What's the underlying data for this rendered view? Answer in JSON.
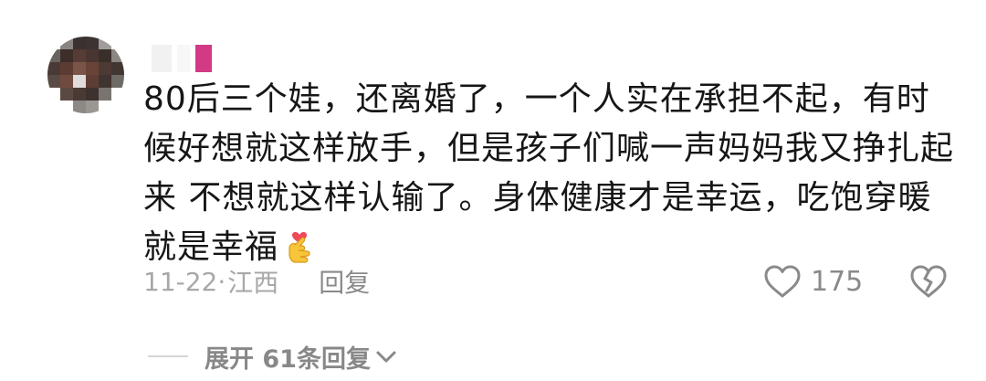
{
  "comment": {
    "author": {
      "avatar_icon": "blurred-avatar-icon",
      "name_icon": "blurred-username"
    },
    "text": "80后三个娃，还离婚了，一个人实在承担不起，有时候好想就这样放手，但是孩子们喊一声妈妈我又挣扎起来 不想就这样认输了。身体健康才是幸运，吃饱穿暖就是幸福",
    "emoji_icon": "finger-heart-emoji",
    "date": "11-22",
    "separator": "·",
    "location": "江西",
    "reply_label": "回复",
    "like_icon": "heart-outline-icon",
    "like_count": "175",
    "dislike_icon": "broken-heart-icon"
  },
  "replies": {
    "expand_label": "展开 61条回复",
    "expand_icon": "chevron-down-icon"
  },
  "colors": {
    "text_primary": "#161616",
    "text_meta": "#a8a8a8",
    "text_secondary": "#8a8a8a"
  }
}
